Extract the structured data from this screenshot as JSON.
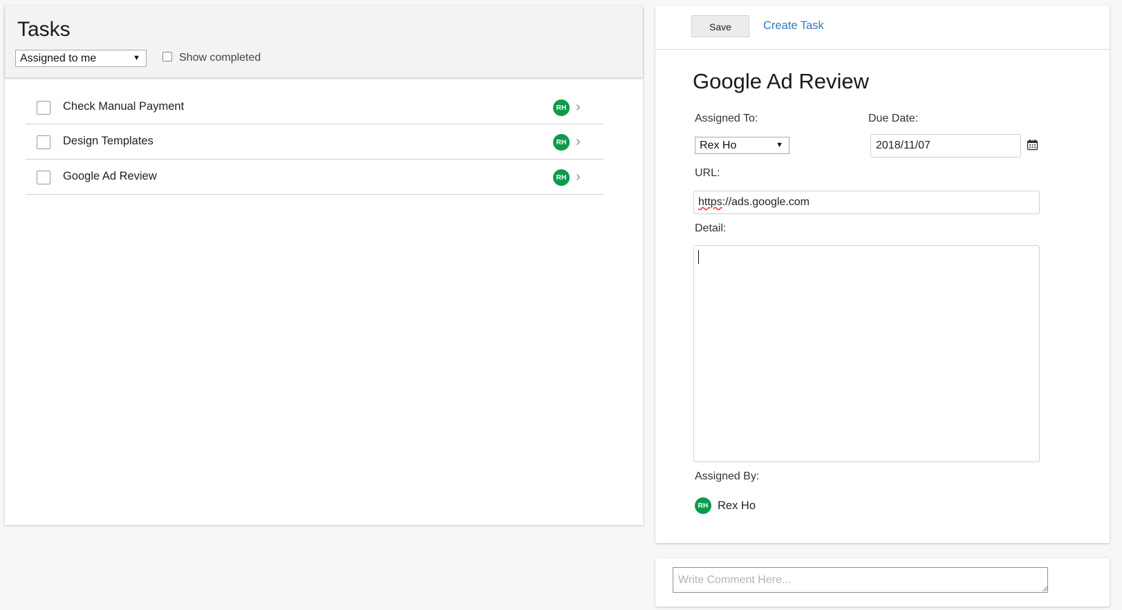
{
  "left": {
    "title": "Tasks",
    "filter": {
      "selected": "Assigned to me"
    },
    "show_completed_label": "Show completed",
    "tasks": [
      {
        "label": "Check Manual Payment",
        "assignee_initials": "RH"
      },
      {
        "label": "Design Templates",
        "assignee_initials": "RH"
      },
      {
        "label": "Google Ad Review",
        "assignee_initials": "RH"
      }
    ]
  },
  "toolbar": {
    "save_label": "Save",
    "create_task_label": "Create Task"
  },
  "detail": {
    "title": "Google Ad Review",
    "assigned_to_label": "Assigned To:",
    "assigned_to_value": "Rex Ho",
    "due_date_label": "Due Date:",
    "due_date_value": "2018/11/07",
    "url_label": "URL:",
    "url_value_prefix": "https",
    "url_value_rest": "://ads.google.com",
    "detail_label": "Detail:",
    "detail_value": "",
    "assigned_by_label": "Assigned By:",
    "assigned_by_initials": "RH",
    "assigned_by_name": "Rex Ho"
  },
  "comment": {
    "placeholder": "Write Comment Here..."
  },
  "colors": {
    "avatar": "#0c9b4a",
    "link": "#2a7bc4"
  },
  "icons": {
    "chevron": "chevron-right-icon",
    "calendar": "calendar-icon",
    "dropdown": "caret-down-icon"
  }
}
